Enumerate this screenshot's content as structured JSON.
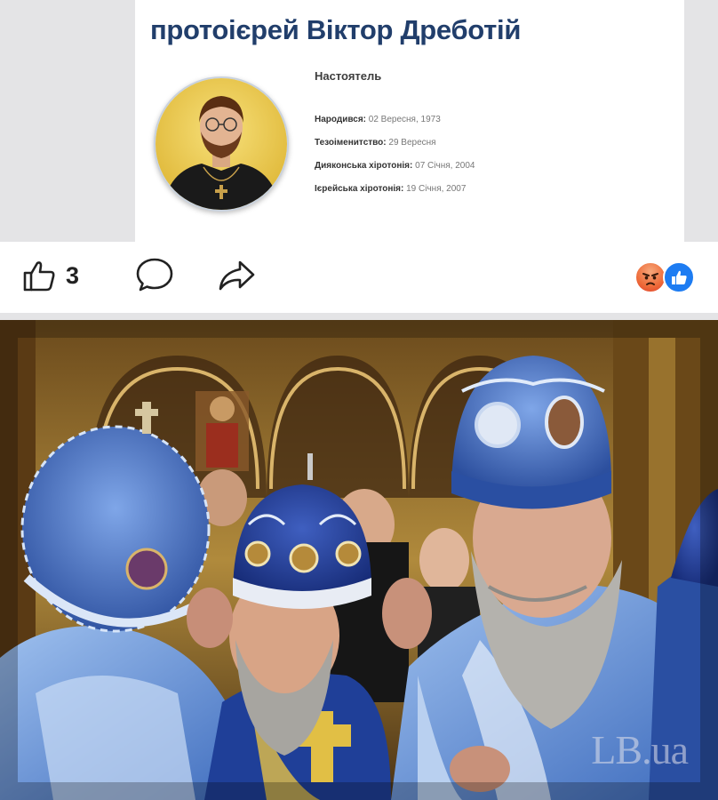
{
  "profile_card": {
    "title": "протоієрей Віктор Дреботій",
    "role": "Настоятель",
    "facts": [
      {
        "label": "Народився:",
        "value": "02 Вересня, 1973"
      },
      {
        "label": "Тезоіменитство:",
        "value": "29 Вересня"
      },
      {
        "label": "Дияконська хіротонія:",
        "value": "07 Січня, 2004"
      },
      {
        "label": "Ієрейська хіротонія:",
        "value": "19 Січня, 2007"
      }
    ]
  },
  "actions": {
    "like_count": "3",
    "like_icon": "thumbs-up-outline-icon",
    "comment_icon": "speech-bubble-icon",
    "share_icon": "share-arrow-icon",
    "reactions": [
      "angry-reaction-icon",
      "like-reaction-icon"
    ]
  },
  "photo": {
    "watermark": "LB.ua"
  },
  "colors": {
    "title": "#213e6b",
    "like_reaction": "#1d7cf2",
    "angry_reaction": "#ee6c3a",
    "vestment_blue": "#2f5fb0"
  }
}
